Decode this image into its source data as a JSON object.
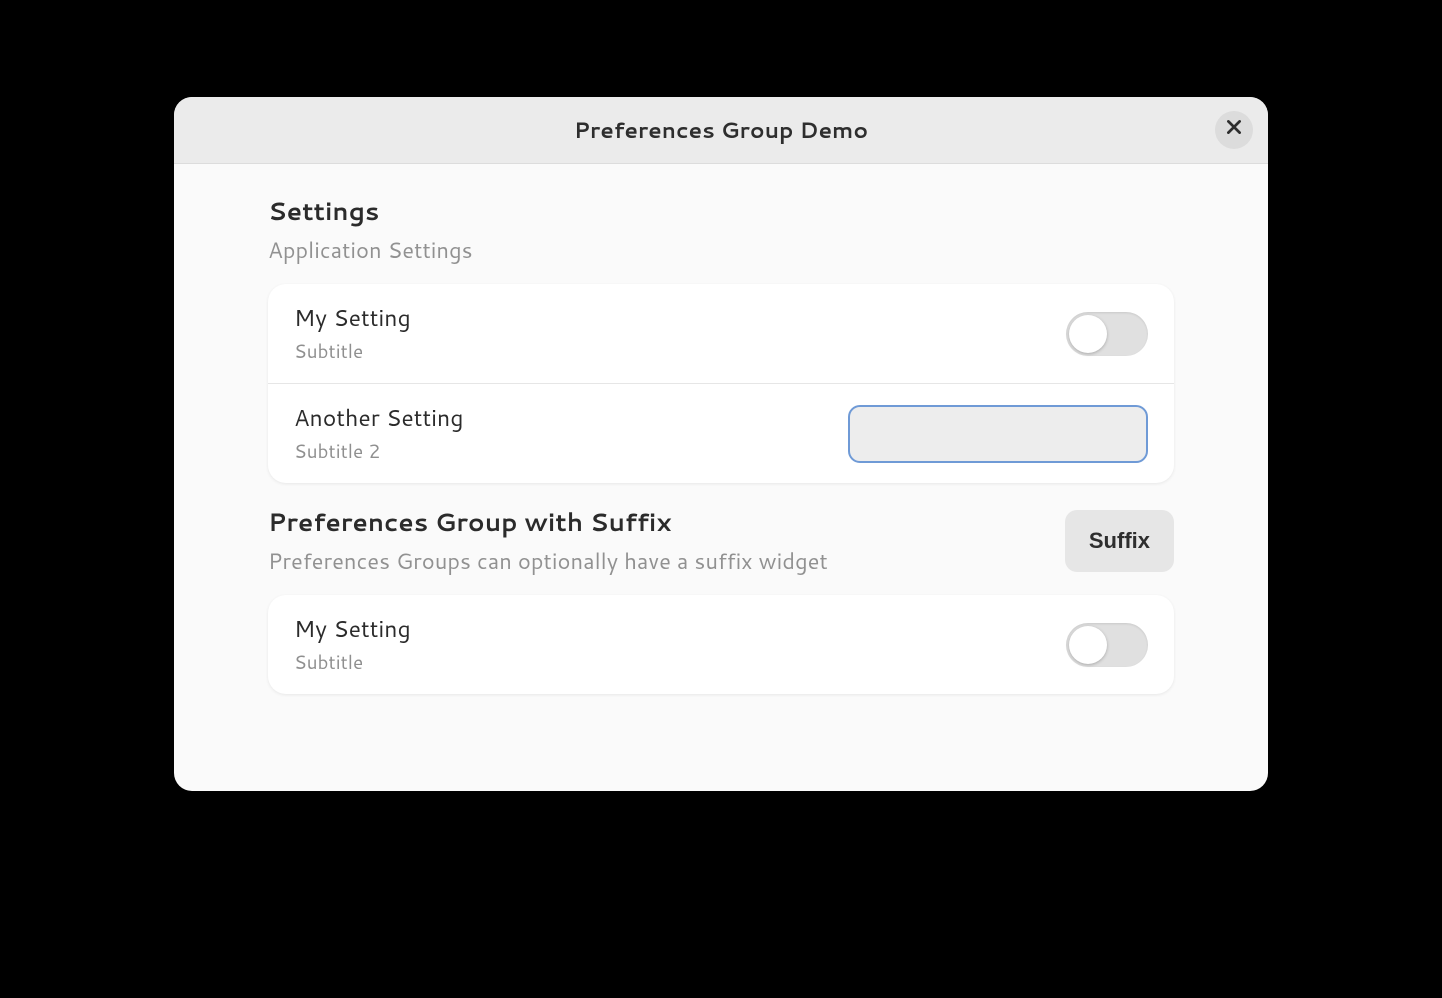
{
  "header": {
    "title": "Preferences Group Demo"
  },
  "groups": [
    {
      "title": "Settings",
      "description": "Application Settings",
      "suffix": null,
      "rows": [
        {
          "title": "My Setting",
          "subtitle": "Subtitle",
          "type": "switch",
          "value": false
        },
        {
          "title": "Another Setting",
          "subtitle": "Subtitle 2",
          "type": "entry",
          "value": ""
        }
      ]
    },
    {
      "title": "Preferences Group with Suffix",
      "description": "Preferences Groups can optionally have a suffix widget",
      "suffix": "Suffix",
      "rows": [
        {
          "title": "My Setting",
          "subtitle": "Subtitle",
          "type": "switch",
          "value": false
        }
      ]
    }
  ]
}
